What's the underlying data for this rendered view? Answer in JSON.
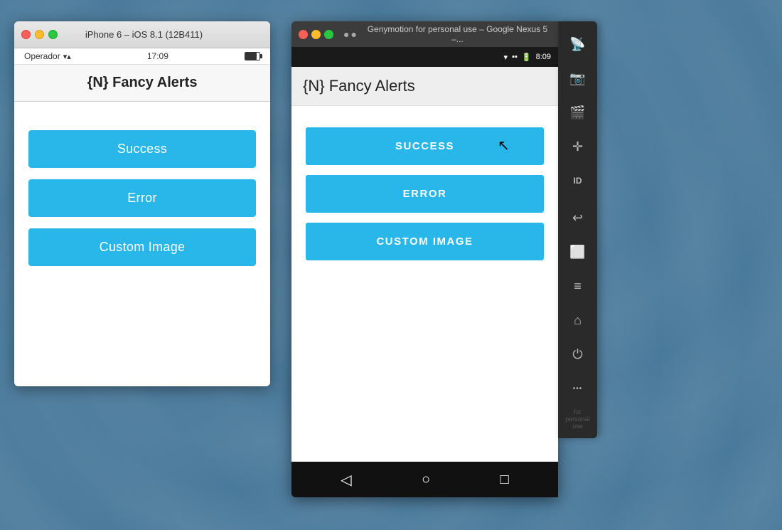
{
  "background": {
    "color": "#4a7a9b"
  },
  "ios_simulator": {
    "title_bar": {
      "window_title": "iPhone 6 – iOS 8.1 (12B411)"
    },
    "status_bar": {
      "carrier": "Operador",
      "time": "17:09"
    },
    "app": {
      "title": "{N} Fancy Alerts",
      "buttons": [
        {
          "label": "Success",
          "id": "ios-success-btn"
        },
        {
          "label": "Error",
          "id": "ios-error-btn"
        },
        {
          "label": "Custom Image",
          "id": "ios-custom-btn"
        }
      ]
    }
  },
  "android_simulator": {
    "title_bar": {
      "window_title": "Genymotion for personal use – Google Nexus 5 –...",
      "dots": "●●"
    },
    "status_bar": {
      "time": "8:09"
    },
    "app": {
      "title": "{N} Fancy Alerts",
      "buttons": [
        {
          "label": "SUCCESS",
          "id": "and-success-btn"
        },
        {
          "label": "ERROR",
          "id": "and-error-btn"
        },
        {
          "label": "CUSTOM IMAGE",
          "id": "and-custom-btn"
        }
      ]
    },
    "nav": {
      "back_icon": "◁",
      "home_icon": "○",
      "recents_icon": "□"
    },
    "sidebar": {
      "icons": [
        {
          "name": "wifi-icon",
          "glyph": "📶"
        },
        {
          "name": "camera-icon",
          "glyph": "📷"
        },
        {
          "name": "film-icon",
          "glyph": "🎬"
        },
        {
          "name": "move-icon",
          "glyph": "✛"
        },
        {
          "name": "id-icon",
          "glyph": "ID"
        },
        {
          "name": "back-icon",
          "glyph": "↩"
        },
        {
          "name": "home2-icon",
          "glyph": "⬜"
        },
        {
          "name": "menu-icon",
          "glyph": "≡"
        },
        {
          "name": "home3-icon",
          "glyph": "⌂"
        },
        {
          "name": "power-icon",
          "glyph": "⏻"
        },
        {
          "name": "more-icon",
          "glyph": "•••"
        }
      ],
      "watermark": "for personal use"
    }
  }
}
